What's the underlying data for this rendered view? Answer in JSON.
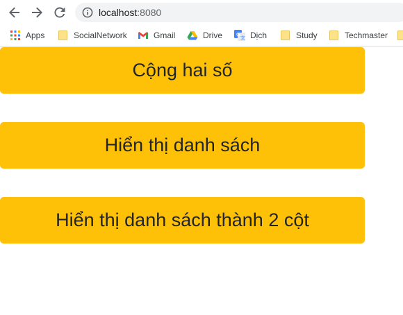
{
  "browser": {
    "url_host": "localhost",
    "url_port": ":8080",
    "bookmarks": [
      {
        "label": "Apps",
        "icon": "apps-grid-icon"
      },
      {
        "label": "SocialNetwork",
        "icon": "folder-icon"
      },
      {
        "label": "Gmail",
        "icon": "gmail-icon"
      },
      {
        "label": "Drive",
        "icon": "drive-icon"
      },
      {
        "label": "Dịch",
        "icon": "translate-icon"
      },
      {
        "label": "Study",
        "icon": "folder-icon"
      },
      {
        "label": "Techmaster",
        "icon": "folder-icon"
      },
      {
        "label": "",
        "icon": "folder-icon"
      }
    ]
  },
  "main": {
    "buttons": [
      {
        "label": "Cộng hai số"
      },
      {
        "label": "Hiển thị danh sách"
      },
      {
        "label": "Hiển thị danh sách thành 2 cột"
      }
    ]
  },
  "colors": {
    "button_bg": "#ffc107",
    "button_text": "#212529",
    "omnibox_bg": "#f1f3f4"
  }
}
